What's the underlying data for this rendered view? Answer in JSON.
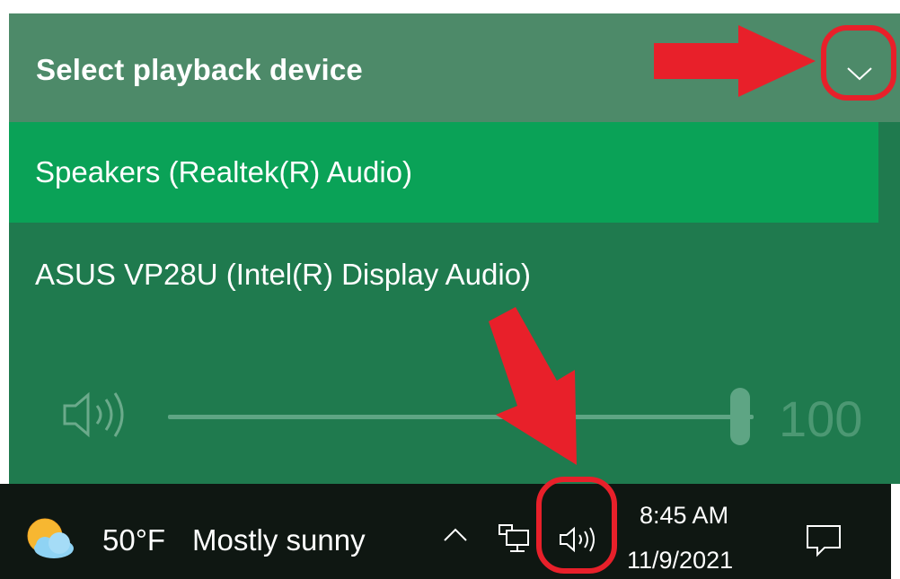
{
  "flyout": {
    "title": "Select playback device",
    "devices": [
      {
        "label": "Speakers (Realtek(R) Audio)",
        "selected": true
      },
      {
        "label": "ASUS VP28U (Intel(R) Display Audio)",
        "selected": false
      }
    ],
    "volume": {
      "value": "100",
      "level": 1.0,
      "icon": "speaker-icon"
    },
    "expand_icon": "chevron-down-icon"
  },
  "taskbar": {
    "weather": {
      "temp": "50°F",
      "condition": "Mostly sunny",
      "icon": "partly-sunny-icon"
    },
    "tray_icons": [
      "chevron-up-icon",
      "network-icon",
      "speaker-icon"
    ],
    "clock": {
      "time": "8:45 AM",
      "date": "11/9/2021"
    },
    "action_center_icon": "notification-icon"
  },
  "colors": {
    "header_bg": "#4d8a69",
    "list_bg": "#1f7a4e",
    "selected_bg": "#0aa257",
    "taskbar_bg": "#0f1712",
    "annotation": "#e8202a"
  }
}
